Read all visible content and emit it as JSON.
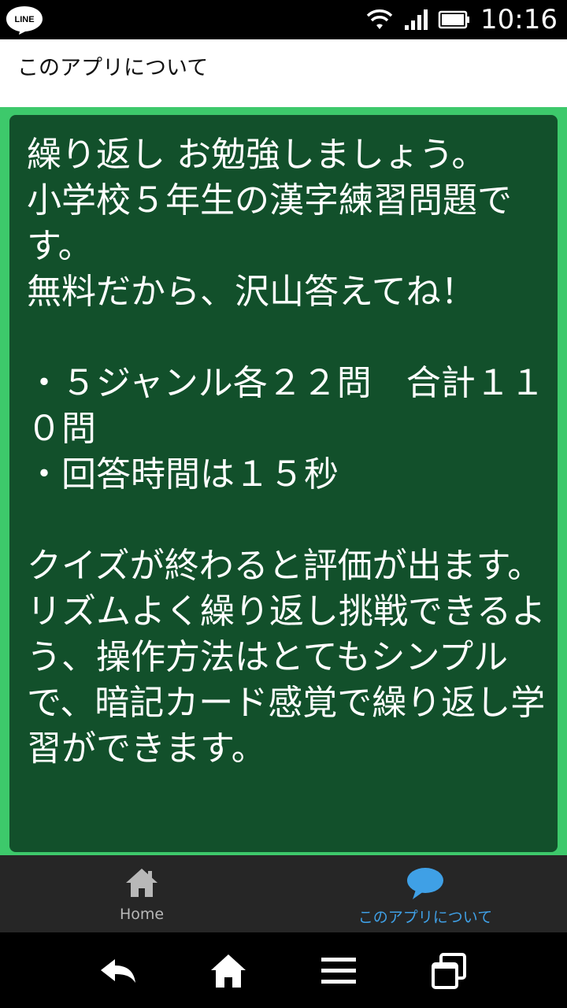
{
  "status": {
    "app_badge": "LINE",
    "time": "10:16",
    "icons": [
      "line-app-icon",
      "wifi-icon",
      "signal-icon",
      "battery-icon"
    ]
  },
  "header": {
    "title": "このアプリについて"
  },
  "main": {
    "description": "繰り返し お勉強しましょう。\n小学校５年生の漢字練習問題です。\n無料だから、沢山答えてね！\n\n・５ジャンル各２２問　合計１１０問\n・回答時間は１５秒\n\nクイズが終わると評価が出ます。\nリズムよく繰り返し挑戦できるよう、操作方法はとてもシンプルで、暗記カード感覚で繰り返し学習ができます。"
  },
  "tabs": [
    {
      "label": "Home",
      "icon": "home-icon",
      "active": false
    },
    {
      "label": "このアプリについて",
      "icon": "chat-bubble-icon",
      "active": true
    }
  ],
  "navbar": {
    "icons": [
      "back-icon",
      "home-icon",
      "menu-icon",
      "recent-apps-icon"
    ]
  },
  "colors": {
    "board": "#12502b",
    "board_border": "#3dc96b",
    "active_tab": "#3fa0e6",
    "tabbar": "#262626"
  }
}
